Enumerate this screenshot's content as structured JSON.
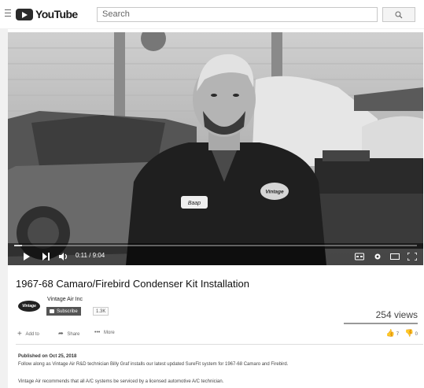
{
  "header": {
    "logo_text": "YouTube",
    "search_placeholder": "Search"
  },
  "player": {
    "time_current": "0:11",
    "time_total": "9:04",
    "time_display": "0:11 / 9:04",
    "progress": 0.02,
    "shirt_patch_text": "Vintage",
    "name_tag_text": "Baap"
  },
  "video": {
    "title": "1967-68 Camaro/Firebird Condenser Kit Installation",
    "channel": {
      "name": "Vintage Air Inc",
      "logo_text": "Vintage",
      "subscribe_label": "Subscribe",
      "subscriber_count": "1.3K"
    },
    "views": "254 views",
    "actions": {
      "add_to": "Add to",
      "share": "Share",
      "more": "More",
      "likes": "7",
      "dislikes": "0"
    },
    "published": "Published on Oct 25, 2018",
    "description": [
      "Follow along as Vintage Air R&D technician Billy Graf installs our latest updated SureFit system for 1967-68 Camaro and Firebird.",
      "Vintage Air recommends that all A/C systems be serviced by a licensed automotive A/C technician."
    ]
  }
}
